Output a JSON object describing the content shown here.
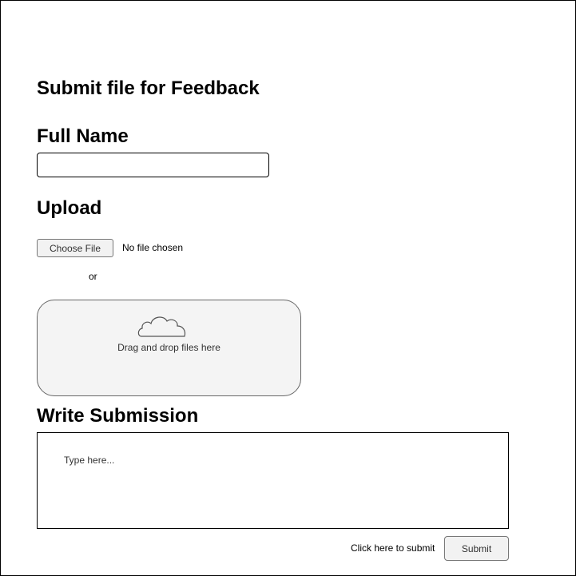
{
  "page": {
    "title": "Submit file for Feedback"
  },
  "full_name": {
    "label": "Full Name",
    "value": "",
    "placeholder": ""
  },
  "upload": {
    "label": "Upload",
    "choose_button_label": "Choose File",
    "no_file_text": "No file chosen",
    "or_text": "or",
    "dropzone_text": "Drag and drop files here",
    "dropzone_icon": "cloud-icon"
  },
  "submission": {
    "label": "Write Submission",
    "placeholder": "Type here...",
    "hint_text": "Click here to submit",
    "submit_label": "Submit"
  },
  "colors": {
    "border": "#000000",
    "button_bg": "#f2f2f2",
    "dropzone_bg": "#f4f4f4"
  }
}
